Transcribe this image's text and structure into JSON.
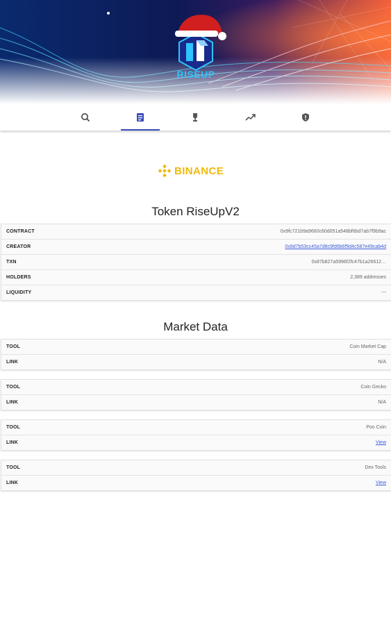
{
  "app": {
    "brand": "RISEUP"
  },
  "nav": {
    "tabs": [
      {
        "icon": "search-icon"
      },
      {
        "icon": "document-icon"
      },
      {
        "icon": "trophy-icon"
      },
      {
        "icon": "trending-icon"
      },
      {
        "icon": "shield-icon"
      }
    ],
    "active_index": 1
  },
  "exchange": {
    "name": "BINANCE"
  },
  "token": {
    "title": "Token RiseUpV2",
    "rows": [
      {
        "label": "CONTRACT",
        "value": "0x9fc721b9a9660c60d051a548bf6bd7ab7f9b9ac",
        "link": false
      },
      {
        "label": "CREATOR",
        "value": "0x8d7b53cc45a7d8c9fd6b6f9d4c587e49cab4d",
        "link": true
      },
      {
        "label": "TXN",
        "value": "0x87b827a5996f2fc47b1a26612…",
        "link": false
      },
      {
        "label": "HOLDERS",
        "value": "2,389 addresses",
        "link": false
      },
      {
        "label": "LIQUIDITY",
        "value": "---",
        "link": false
      }
    ]
  },
  "market": {
    "title": "Market Data",
    "cards": [
      {
        "tool_label": "TOOL",
        "tool": "Coin Market Cap",
        "link_label": "LINK",
        "link": "N/A",
        "is_link": false
      },
      {
        "tool_label": "TOOL",
        "tool": "Coin Gecko",
        "link_label": "LINK",
        "link": "N/A",
        "is_link": false
      },
      {
        "tool_label": "TOOL",
        "tool": "Poo Coin",
        "link_label": "LINK",
        "link": "View",
        "is_link": true
      },
      {
        "tool_label": "TOOL",
        "tool": "Dex Tools",
        "link_label": "LINK",
        "link": "View",
        "is_link": true
      }
    ]
  },
  "colors": {
    "accent": "#3b4db8",
    "binance": "#f0b90b",
    "link": "#3b5bdb"
  }
}
